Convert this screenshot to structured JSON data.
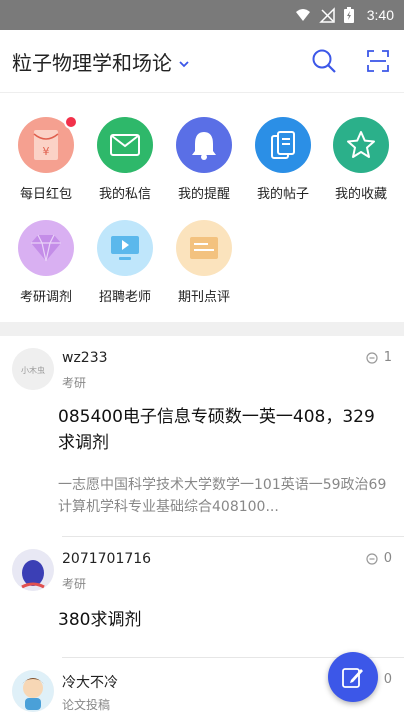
{
  "status_bar": {
    "time": "3:40"
  },
  "header": {
    "title": "粒子物理学和场论"
  },
  "shortcuts": [
    {
      "label": "每日红包",
      "icon": "red-envelope-icon",
      "color": "#f28f7d",
      "badge": true
    },
    {
      "label": "我的私信",
      "icon": "envelope-icon",
      "color": "#2eb86a",
      "badge": false
    },
    {
      "label": "我的提醒",
      "icon": "bell-icon",
      "color": "#5a6fe6",
      "badge": false
    },
    {
      "label": "我的帖子",
      "icon": "documents-icon",
      "color": "#2b8fe6",
      "badge": false
    },
    {
      "label": "我的收藏",
      "icon": "star-icon",
      "color": "#2bb08a",
      "badge": false
    },
    {
      "label": "考研调剂",
      "icon": "diamond-icon",
      "color": "#d6a8f0",
      "badge": false
    },
    {
      "label": "招聘老师",
      "icon": "monitor-play-icon",
      "color": "#8fd0f0",
      "badge": false
    },
    {
      "label": "期刊点评",
      "icon": "card-icon",
      "color": "#f6d9a8",
      "badge": false
    }
  ],
  "posts": [
    {
      "user": "wz233",
      "category": "考研",
      "replies": "1",
      "title": "085400电子信息专硕数一英一408，329求调剂",
      "excerpt": "一志愿中国科学技术大学数学一101英语一59政治69计算机学科专业基础综合408100..."
    },
    {
      "user": "2071701716",
      "category": "考研",
      "replies": "0",
      "title": "380求调剂",
      "excerpt": ""
    },
    {
      "user": "冷大不冷",
      "category": "论文投稿",
      "replies": "0",
      "title": "",
      "excerpt": ""
    }
  ]
}
